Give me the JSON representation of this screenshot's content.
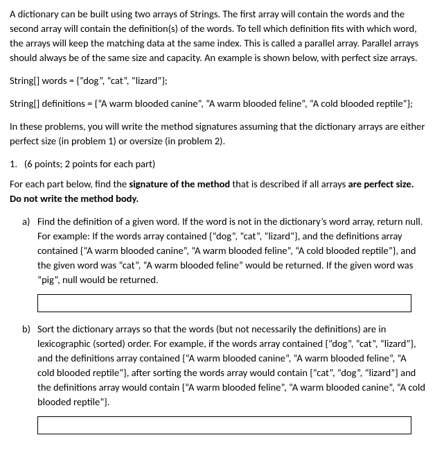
{
  "intro": {
    "p1": "A dictionary can be built using two arrays of Strings. The first array will contain the words and the second array will contain the definition(s) of the words. To tell which definition fits with which word, the arrays will keep the matching data at the same index. This is called a parallel array. Parallel arrays should always be of the same size and capacity. An example is shown below, with perfect size arrays.",
    "code1": "String[] words = {“dog”, “cat”, “lizard”};",
    "code2": "String[] definitions = {“A warm blooded canine”, “A warm blooded feline”, “A  cold blooded reptile”};",
    "p2": "In these problems, you will write the method signatures assuming that the dictionary arrays are either perfect size (in problem 1) or oversize (in problem 2)."
  },
  "q1": {
    "header_num": "1.",
    "header_points": "(6 points; 2 points for each part)",
    "instruction_pre": "For each part below, find the ",
    "instruction_bold1": "signature of the method",
    "instruction_mid": " that is described if all arrays ",
    "instruction_bold2": "are perfect size. Do not write the method body.",
    "a": {
      "marker": "a)",
      "text": "Find the definition of a given word. If the word is not in the dictionary’s word array, return null. For example: If the words array contained {“dog”, “cat”, “lizard”}, and the definitions array contained {“A warm blooded canine”, “A warm blooded feline”, “A cold blooded reptile”}, and the given word was “cat”, “A warm blooded feline” would be returned. If the given word was “pig”, null would be returned.",
      "answer": ""
    },
    "b": {
      "marker": "b)",
      "text": "Sort the dictionary arrays so that the words (but not necessarily the definitions) are in lexicographic (sorted) order.  For example, if the words array contained {“dog”, “cat”, “lizard”}, and the definitions array contained {“A warm blooded canine”, “A warm blooded feline”, “A cold blooded reptile”}, after sorting the words array would contain {“cat”, “dog”, “lizard”} and the definitions array would contain {“A warm blooded feline”, “A warm blooded canine”, “A cold blooded reptile”}.",
      "answer": ""
    }
  }
}
